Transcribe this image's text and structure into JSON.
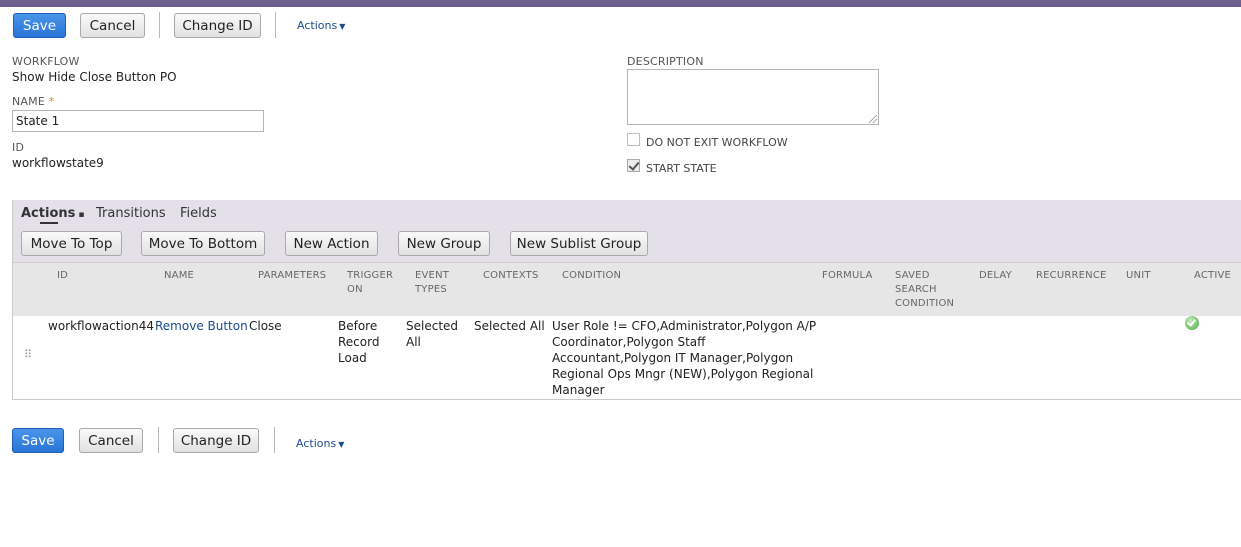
{
  "toolbar": {
    "save_label": "Save",
    "cancel_label": "Cancel",
    "change_id_label": "Change ID",
    "actions_label": "Actions"
  },
  "form": {
    "workflow_label": "WORKFLOW",
    "workflow_value": "Show Hide Close Button PO",
    "name_label": "NAME",
    "name_required": "*",
    "name_value": "State 1",
    "id_label": "ID",
    "id_value": "workflowstate9",
    "description_label": "DESCRIPTION",
    "description_value": "",
    "do_not_exit_label": "DO NOT EXIT WORKFLOW",
    "do_not_exit_checked": false,
    "start_state_label": "START STATE",
    "start_state_checked": true
  },
  "subtabs": {
    "actions": "Actions",
    "transitions": "Transitions",
    "fields": "Fields"
  },
  "sublist_buttons": {
    "move_to_top": "Move To Top",
    "move_to_bottom": "Move To Bottom",
    "new_action": "New Action",
    "new_group": "New Group",
    "new_sublist_group": "New Sublist Group"
  },
  "table": {
    "columns": {
      "id": "ID",
      "name": "NAME",
      "parameters": "PARAMETERS",
      "trigger_on_1": "TRIGGER",
      "trigger_on_2": "ON",
      "event_types_1": "EVENT",
      "event_types_2": "TYPES",
      "contexts": "CONTEXTS",
      "condition": "CONDITION",
      "formula": "FORMULA",
      "saved_search_1": "SAVED",
      "saved_search_2": "SEARCH",
      "saved_search_3": "CONDITION",
      "delay": "DELAY",
      "recurrence": "RECURRENCE",
      "unit": "UNIT",
      "active": "ACTIVE"
    },
    "rows": [
      {
        "id": "workflowaction44",
        "name": "Remove Button",
        "parameters": "Close",
        "trigger_on_1": "Before",
        "trigger_on_2": "Record",
        "trigger_on_3": "Load",
        "event_types_1": "Selected",
        "event_types_2": "All",
        "contexts": "Selected All",
        "condition_1": "User Role != CFO,Administrator,Polygon A/P",
        "condition_2": "Coordinator,Polygon Staff",
        "condition_3": "Accountant,Polygon IT Manager,Polygon",
        "condition_4": "Regional Ops Mngr (NEW),Polygon Regional",
        "condition_5": "Manager",
        "active": true
      }
    ]
  }
}
